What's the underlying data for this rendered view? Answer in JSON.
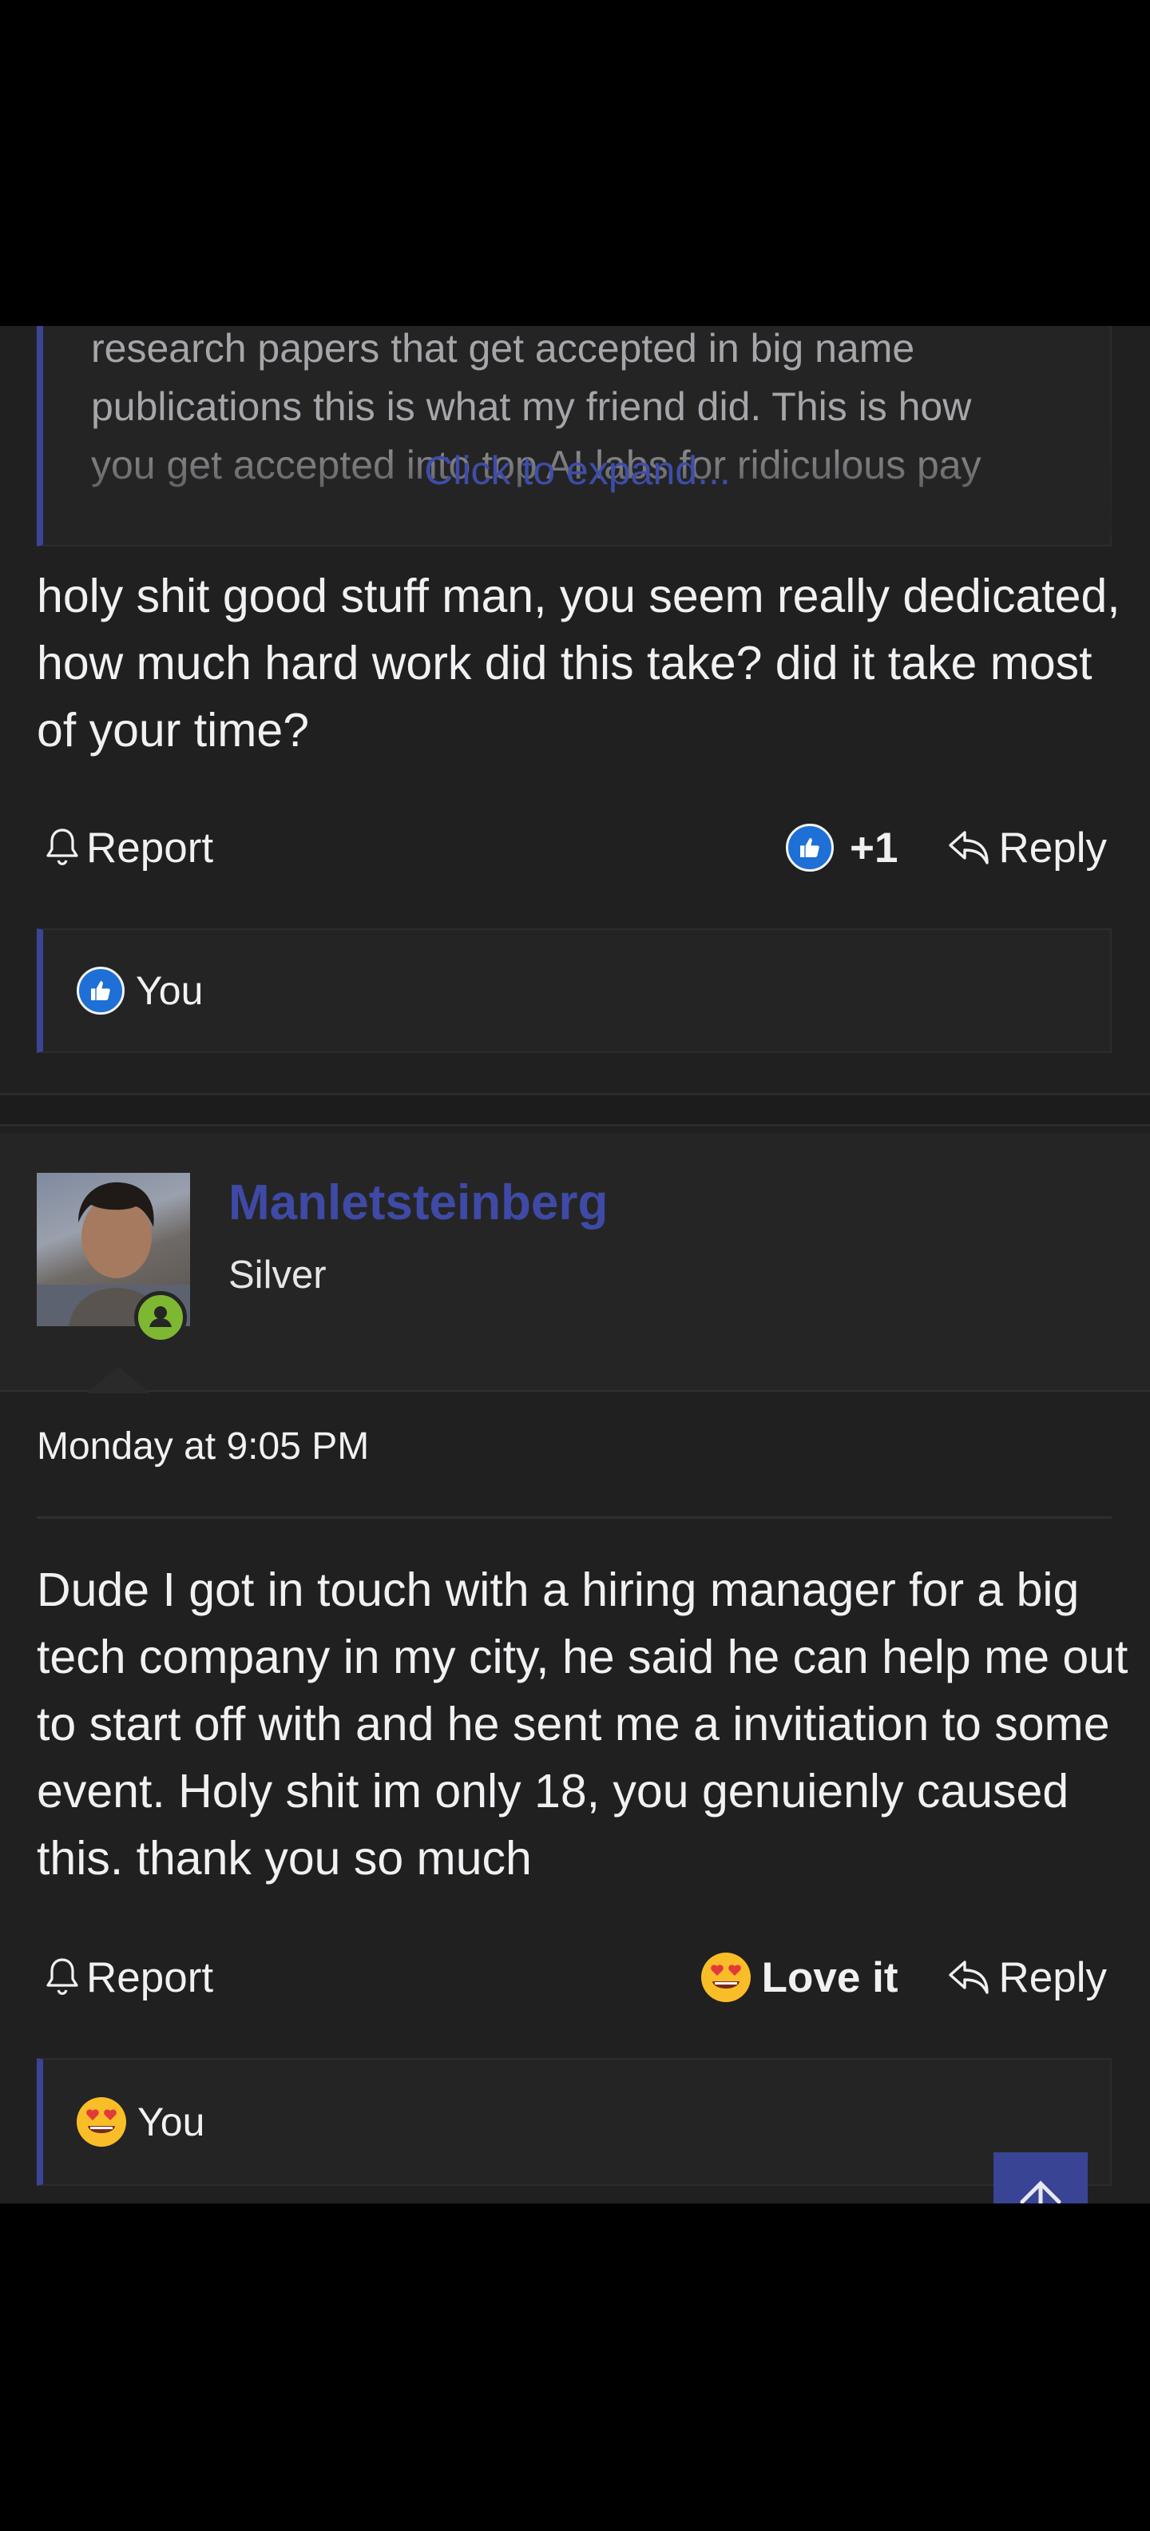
{
  "quote": {
    "text": "research papers that get accepted in big name\npublications this is what my friend did. This is how\nyou get accepted into top AI labs for ridiculous pay",
    "expand_label": "Click to expand..."
  },
  "post1": {
    "body": "holy shit good stuff man, you seem really dedicated, how much hard work did this take? did it take most of your time?",
    "report_label": "Report",
    "reaction_label": "+1",
    "reply_label": "Reply",
    "reactions_by": "You"
  },
  "post2": {
    "author": {
      "username": "Manletsteinberg",
      "title": "Silver"
    },
    "date": "Monday at 9:05 PM",
    "body": "Dude I got in touch with a hiring manager for a big tech company in my city, he said he can help me out to start off with and he sent me a invitiation to some event. Holy shit im only 18, you genuienly caused this. thank you so much",
    "report_label": "Report",
    "reaction_label": "Love it",
    "reply_label": "Reply",
    "reactions_by": "You"
  },
  "colors": {
    "accent": "#3e4aa6",
    "background": "#202021",
    "online": "#7eb732"
  },
  "icons": [
    "bell-icon",
    "like-icon",
    "reply-icon",
    "love-it-icon",
    "user-icon",
    "arrow-up-icon"
  ]
}
